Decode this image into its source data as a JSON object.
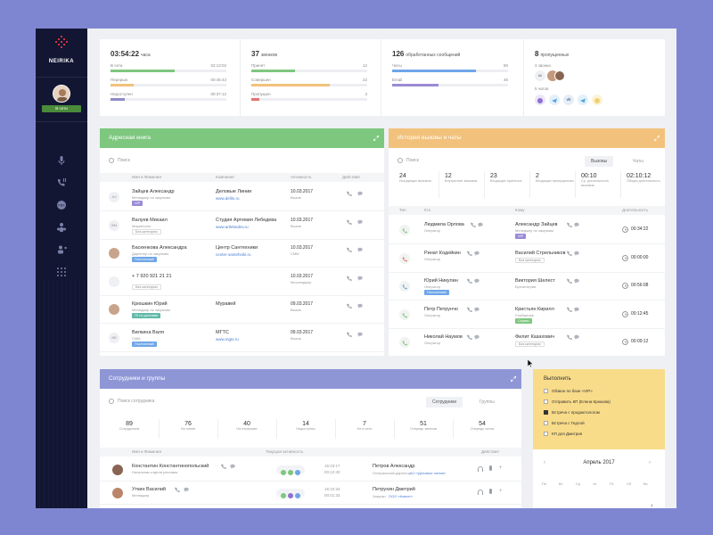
{
  "brand": {
    "name": "NEIRIKA"
  },
  "sidebar": {
    "status": "В сети"
  },
  "stats": {
    "time": {
      "value": "03:54:22",
      "unit": "часа",
      "rows": [
        {
          "label": "В сети",
          "value": "02:13:02",
          "color": "#7ec77f",
          "fill": 0.55
        },
        {
          "label": "Перерыв",
          "value": "00:45:43",
          "color": "#f2c27c",
          "fill": 0.2
        },
        {
          "label": "Недоступен",
          "value": "00:37:12",
          "color": "#8f8ac7",
          "fill": 0.12
        }
      ]
    },
    "calls": {
      "value": "37",
      "unit": "звонков",
      "rows": [
        {
          "label": "Принят",
          "value": "12",
          "color": "#7ec77f",
          "fill": 0.38
        },
        {
          "label": "Совершен",
          "value": "22",
          "color": "#f2c27c",
          "fill": 0.68
        },
        {
          "label": "Пропущен",
          "value": "3",
          "color": "#e57373",
          "fill": 0.07
        }
      ]
    },
    "messages": {
      "value": "126",
      "unit": "обработанных сообщений",
      "rows": [
        {
          "label": "Чаты",
          "value": "80",
          "color": "#6fa6e8",
          "fill": 0.72
        },
        {
          "label": "Email",
          "value": "46",
          "color": "#9b8ad6",
          "fill": 0.4
        }
      ]
    },
    "missed": {
      "value": "8",
      "unit": "пропущенных",
      "calls_label": "3 звонка",
      "chats_label": "5 чатов",
      "all_label": "All"
    }
  },
  "address_book": {
    "title": "Адресная книга",
    "search_placeholder": "Поиск",
    "columns": [
      "Имя и Фамилия",
      "Компания",
      "Активность",
      "Действия"
    ],
    "rows": [
      {
        "initials": "АЗ",
        "name": "Зайцев Александр",
        "role": "Менеджер по закупкам",
        "tag": "VIP",
        "tag_color": "#9b8ad6",
        "company": "Деловые Линии",
        "site": "www.dellin.ru",
        "date": "10.03.2017",
        "act": "Вызов"
      },
      {
        "initials": "ВМ",
        "name": "Валуев Михаил",
        "role": "Маркетолог",
        "tag": "Без категории",
        "tag_color": "gray",
        "company": "Студия Артемия Лебедева",
        "site": "www.artlebedev.ru",
        "date": "10.03.2017",
        "act": "Вызов"
      },
      {
        "initials": "",
        "name": "Баскенкова Александра",
        "role": "Директор по закупкам",
        "tag": "Постоянный",
        "tag_color": "#6fa6e8",
        "company": "Центр Сантехники",
        "site": "center-santehniki.ru",
        "date": "10.03.2017",
        "act": "СММ"
      },
      {
        "initials": "",
        "name": "+ 7 920 921 21 21",
        "role": "",
        "tag": "Без категории",
        "tag_color": "gray",
        "company": "",
        "site": "",
        "date": "10.03.2017",
        "act": "Мессенджер"
      },
      {
        "initials": "",
        "name": "Крюшкин Юрий",
        "role": "Менеджер по закупкам",
        "tag": "ГК по доставке",
        "tag_color": "#5fb9a8",
        "company": "Муравей",
        "site": "",
        "date": "09.03.2017",
        "act": "Вызов"
      },
      {
        "initials": "ВВ",
        "name": "Вилкина Валя",
        "role": "СММ",
        "tag": "Постоянный",
        "tag_color": "#6fa6e8",
        "company": "МГТС",
        "site": "www.mgts.ru",
        "date": "09.03.2017",
        "act": "Вызов"
      }
    ]
  },
  "history": {
    "title": "История вызовы и чаты",
    "search_placeholder": "Поиск",
    "tabs": [
      "Вызовы",
      "Чаты"
    ],
    "kpis": [
      {
        "value": "24",
        "label": "Исходящих вызовов"
      },
      {
        "value": "12",
        "label": "Внутренних вызовов"
      },
      {
        "value": "23",
        "label": "Входящих принятых"
      },
      {
        "value": "2",
        "label": "Входящих пропущенных"
      },
      {
        "value": "00:10",
        "label": "Ср. длительность вызовов"
      },
      {
        "value": "02:10:12",
        "label": "Общая длительность"
      }
    ],
    "columns": [
      "Тип",
      "Кто",
      "Кому",
      "Длительность"
    ],
    "rows": [
      {
        "from": "Людмила Орлова",
        "from_role": "Оператор",
        "from_tag": "",
        "to": "Александр Зайцев",
        "to_role": "Менеджер по закупкам",
        "to_tag": "VIP",
        "to_tag_color": "#9b8ad6",
        "dur": "00:34:22",
        "type_color": "#7ec77f"
      },
      {
        "from": "Ринат Кодейкин",
        "from_role": "Оператор",
        "from_tag": "",
        "to": "Василий Стрельников",
        "to_role": "",
        "to_tag": "Без категории",
        "to_tag_color": "gray",
        "dur": "00:00:00",
        "type_color": "#e57373"
      },
      {
        "from": "Юрий Никулин",
        "from_role": "Оператор",
        "from_tag": "Постоянный",
        "to": "Виктория Шелест",
        "to_role": "Бухгалтерия",
        "to_tag": "",
        "to_tag_color": "",
        "dur": "00:56:08",
        "type_color": "#6fa6e8"
      },
      {
        "from": "Петр Петрунчо",
        "from_role": "Оператор",
        "from_tag": "",
        "to": "Кристьян Кирилл",
        "to_role": "Снабжение",
        "to_tag": "Сервис",
        "to_tag_color": "#7ec77f",
        "dur": "00:12:45",
        "type_color": "#7ec77f"
      },
      {
        "from": "Николай Наумов",
        "from_role": "Оператор",
        "from_tag": "",
        "to": "Филит Казахович",
        "to_role": "",
        "to_tag": "Без категории",
        "to_tag_color": "gray",
        "dur": "00:09:12",
        "type_color": "#7ec77f"
      }
    ]
  },
  "staff": {
    "title": "Сотрудники и группы",
    "search_placeholder": "Поиск сотрудника",
    "tabs": [
      "Сотрудники",
      "Группы"
    ],
    "kpis": [
      {
        "value": "89",
        "label": "Сотрудников"
      },
      {
        "value": "76",
        "label": "На линии"
      },
      {
        "value": "40",
        "label": "На перерыве"
      },
      {
        "value": "14",
        "label": "Недоступны"
      },
      {
        "value": "7",
        "label": "Не в сети"
      },
      {
        "value": "51",
        "label": "Очередь звонков"
      },
      {
        "value": "54",
        "label": "Очередь чатов"
      }
    ],
    "columns": [
      "Имя и Фамилия",
      "Текущая активность",
      "Действия"
    ],
    "rows": [
      {
        "name": "Константин Константинопольский",
        "role": "Начальник отдела рекламы",
        "t1": "16:23:17",
        "t2": "00:12:40",
        "client": "Петров Александр",
        "client_sub": "Генеральный директор",
        "client_link": "АО «Деловые линии»"
      },
      {
        "name": "Уткин Василий",
        "role": "Менеджер",
        "t1": "16:10:34",
        "t2": "00:01:33",
        "client": "Петрухин Дмитрий",
        "client_sub": "Закупки",
        "client_link": "ООО «Ковчег»"
      }
    ]
  },
  "todo": {
    "title": "Выполнить",
    "items": [
      {
        "label": "Обзвон по базе «VIP»",
        "done": false
      },
      {
        "label": "Отправить КП (Елена Крюкова)",
        "done": false
      },
      {
        "label": "Встреча с продюктологом",
        "done": true
      },
      {
        "label": "Встреча с Гедлой",
        "done": false
      },
      {
        "label": "КП для Дмитрия",
        "done": false
      }
    ]
  },
  "calendar": {
    "month": "Апрель 2017",
    "days": [
      "Пн",
      "Вт",
      "Ср",
      "Чт",
      "Пт",
      "Сб",
      "Вс"
    ],
    "first": "1"
  }
}
